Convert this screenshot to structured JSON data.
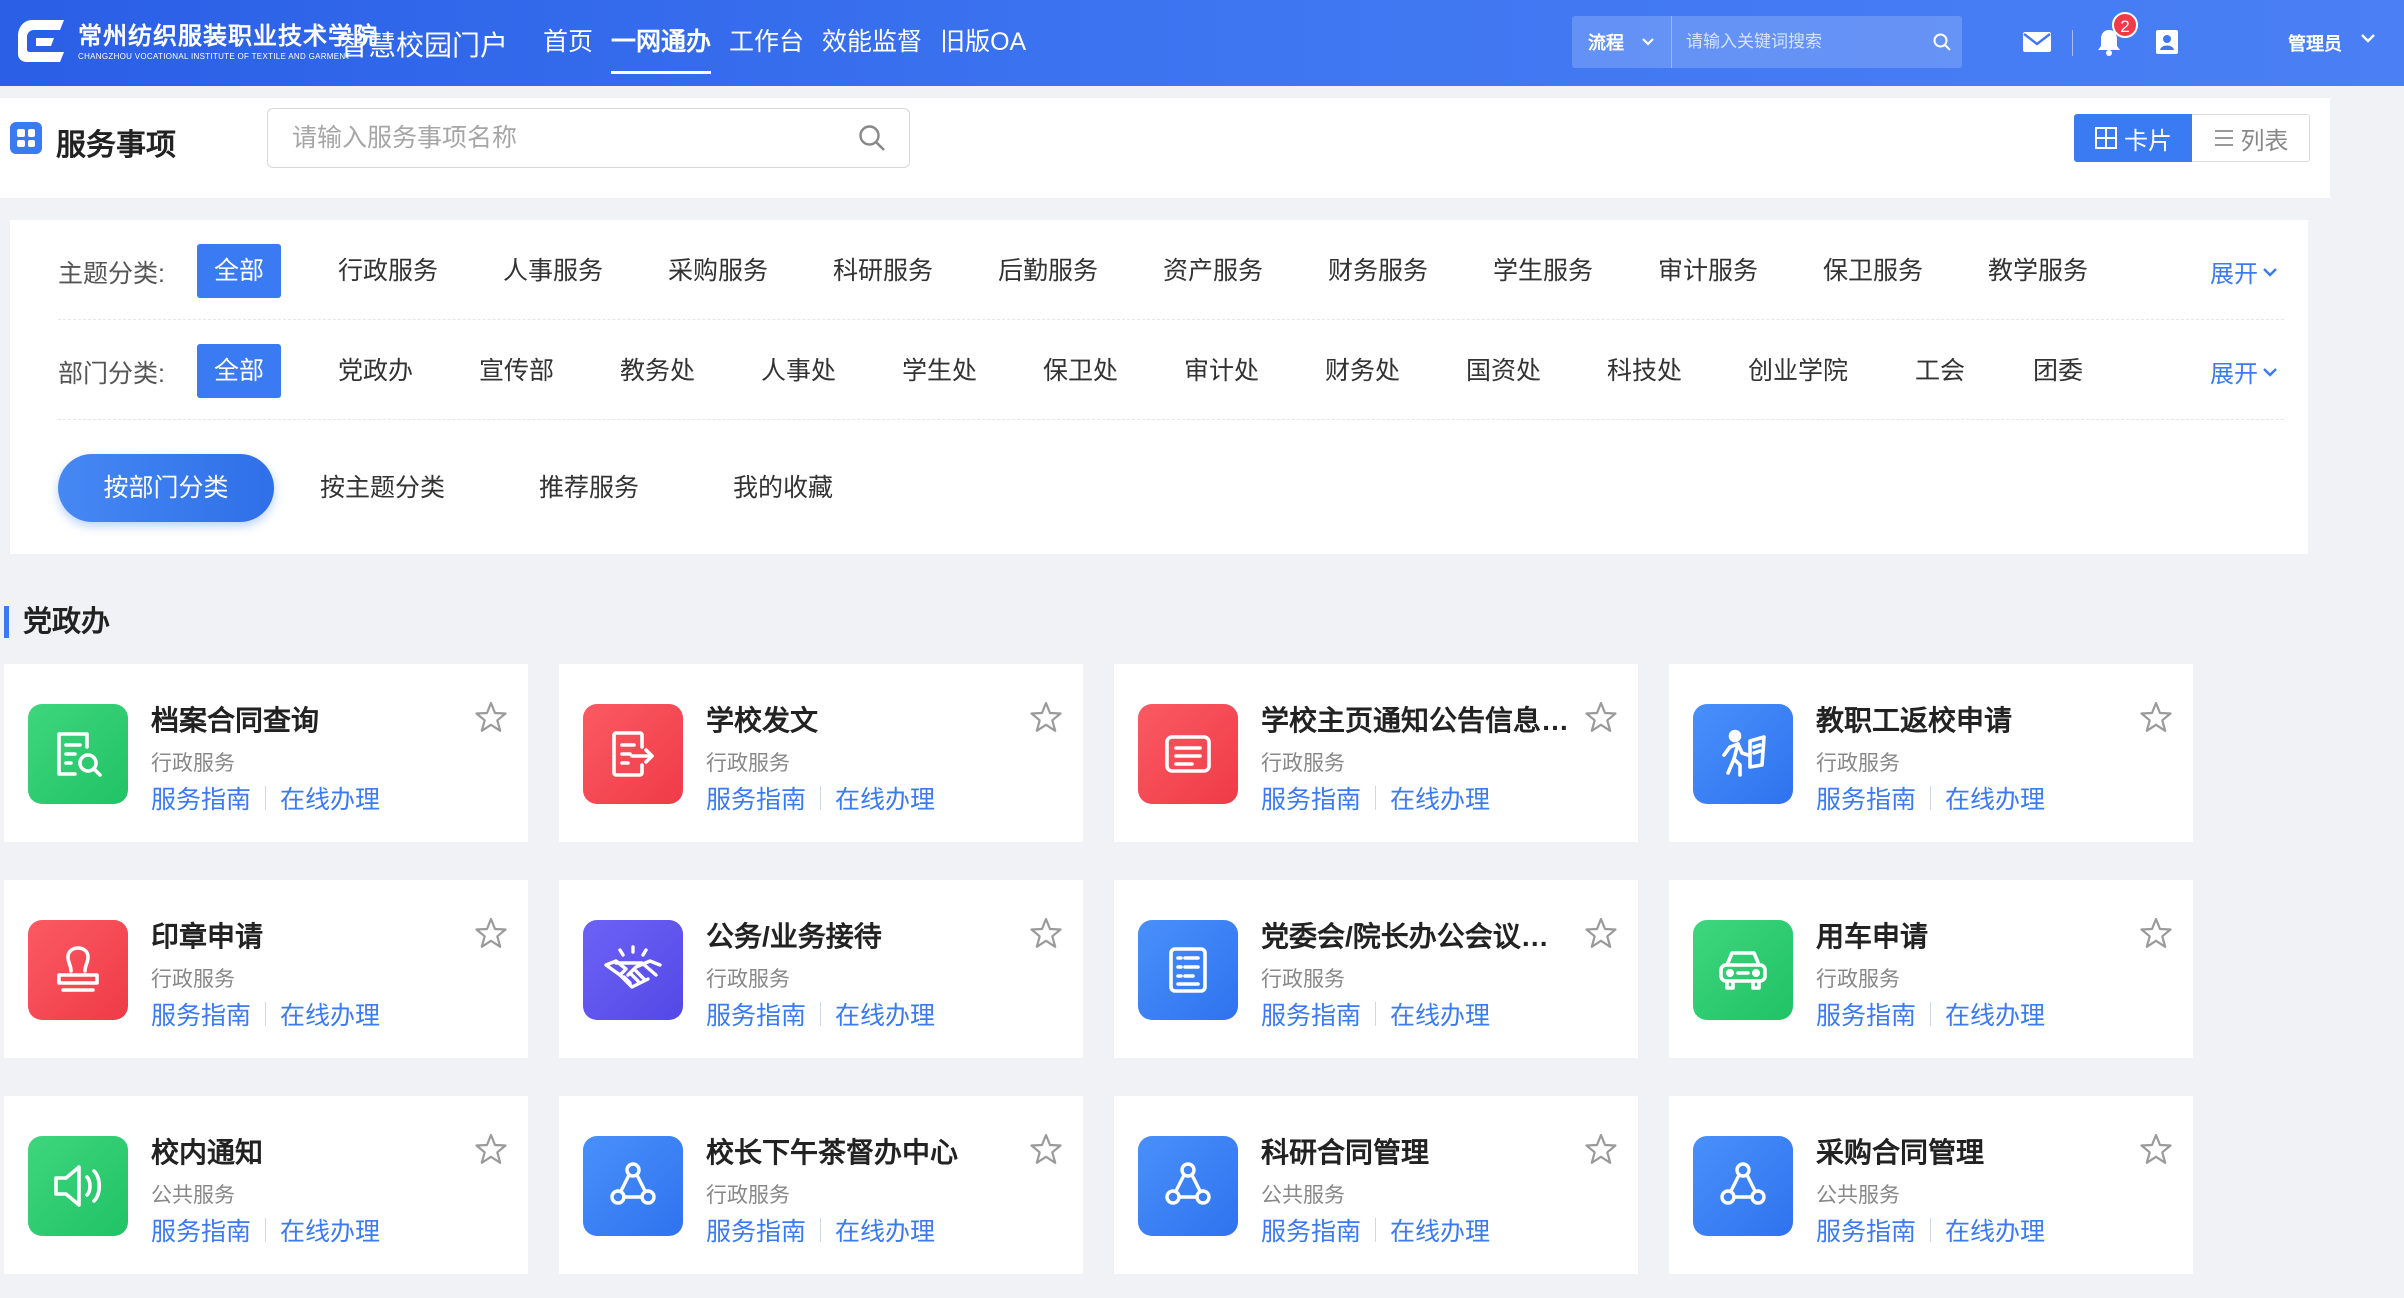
{
  "topbar": {
    "school_name": "常州纺织服装职业技术学院",
    "school_sub": "CHANGZHOU VOCATIONAL INSTITUTE OF TEXTILE AND GARMENT",
    "portal_title": "智慧校园门户",
    "nav": [
      "首页",
      "一网通办",
      "工作台",
      "效能监督",
      "旧版OA"
    ],
    "search_type": "流程",
    "search_placeholder": "请输入关键词搜索",
    "notification_count": "2",
    "user_name": "管理员"
  },
  "title": {
    "text": "服务事项",
    "search_placeholder": "请输入服务事项名称",
    "view_card": "卡片",
    "view_list": "列表"
  },
  "filters": {
    "topic_label": "主题分类:",
    "topics": [
      "全部",
      "行政服务",
      "人事服务",
      "采购服务",
      "科研服务",
      "后勤服务",
      "资产服务",
      "财务服务",
      "学生服务",
      "审计服务",
      "保卫服务",
      "教学服务"
    ],
    "dept_label": "部门分类:",
    "depts": [
      "全部",
      "党政办",
      "宣传部",
      "教务处",
      "人事处",
      "学生处",
      "保卫处",
      "审计处",
      "财务处",
      "国资处",
      "科技处",
      "创业学院",
      "工会",
      "团委"
    ],
    "expand": "展开",
    "tabs": [
      "按部门分类",
      "按主题分类",
      "推荐服务",
      "我的收藏"
    ]
  },
  "section": {
    "title": "党政办",
    "link_guide": "服务指南",
    "link_online": "在线办理",
    "cards": [
      {
        "name": "档案合同查询",
        "category": "行政服务",
        "icon": "document-search-icon",
        "color": "#2dcc72"
      },
      {
        "name": "学校发文",
        "category": "行政服务",
        "icon": "file-send-icon",
        "color": "#f5444f"
      },
      {
        "name": "学校主页通知公告信息发布",
        "category": "行政服务",
        "icon": "notice-board-icon",
        "color": "#f5444f"
      },
      {
        "name": "教职工返校申请",
        "category": "行政服务",
        "icon": "walking-person-icon",
        "color": "#3a7af2"
      },
      {
        "name": "印章申请",
        "category": "行政服务",
        "icon": "stamp-icon",
        "color": "#f5444f"
      },
      {
        "name": "公务/业务接待",
        "category": "行政服务",
        "icon": "handshake-icon",
        "color": "#5d53ee"
      },
      {
        "name": "党委会/院长办公会议题申报",
        "category": "行政服务",
        "icon": "document-list-icon",
        "color": "#3a7af2"
      },
      {
        "name": "用车申请",
        "category": "行政服务",
        "icon": "car-icon",
        "color": "#2dcc72"
      },
      {
        "name": "校内通知",
        "category": "公共服务",
        "icon": "speaker-icon",
        "color": "#2dcc72"
      },
      {
        "name": "校长下午茶督办中心",
        "category": "行政服务",
        "icon": "nodes-icon",
        "color": "#3a7af2"
      },
      {
        "name": "科研合同管理",
        "category": "公共服务",
        "icon": "nodes-icon",
        "color": "#3a7af2"
      },
      {
        "name": "采购合同管理",
        "category": "公共服务",
        "icon": "nodes-icon",
        "color": "#3a7af2"
      }
    ]
  }
}
